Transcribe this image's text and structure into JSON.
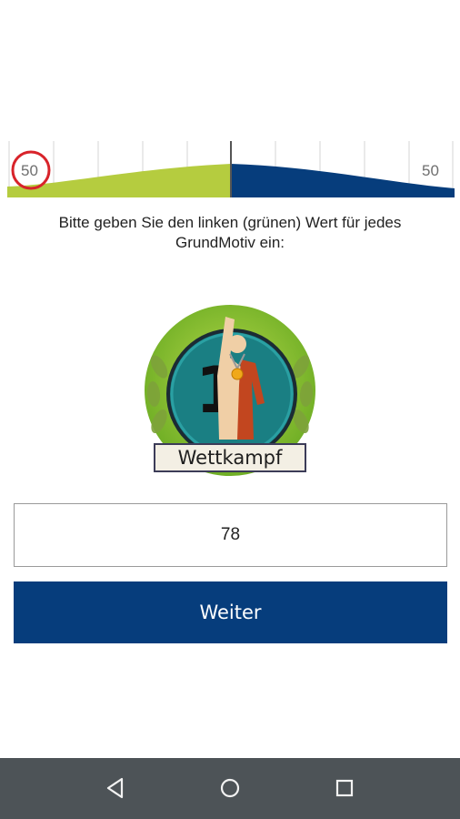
{
  "scale": {
    "left_value": "50",
    "right_value": "50",
    "colors": {
      "left": "#b5cc3f",
      "right": "#063d7c",
      "marker": "#d8232a"
    }
  },
  "instruction": {
    "line1": "Bitte geben Sie den linken (grünen) Wert für jedes",
    "line2": "GrundMotiv ein:"
  },
  "badge": {
    "number": "1",
    "label": "Wettkampf",
    "icon": "winner-figure-with-laurel-wreath"
  },
  "input": {
    "value": "78"
  },
  "button": {
    "label": "Weiter",
    "color": "#063d7c"
  },
  "navbar": {
    "back_icon": "triangle-back-icon",
    "home_icon": "circle-home-icon",
    "recents_icon": "square-recents-icon"
  }
}
